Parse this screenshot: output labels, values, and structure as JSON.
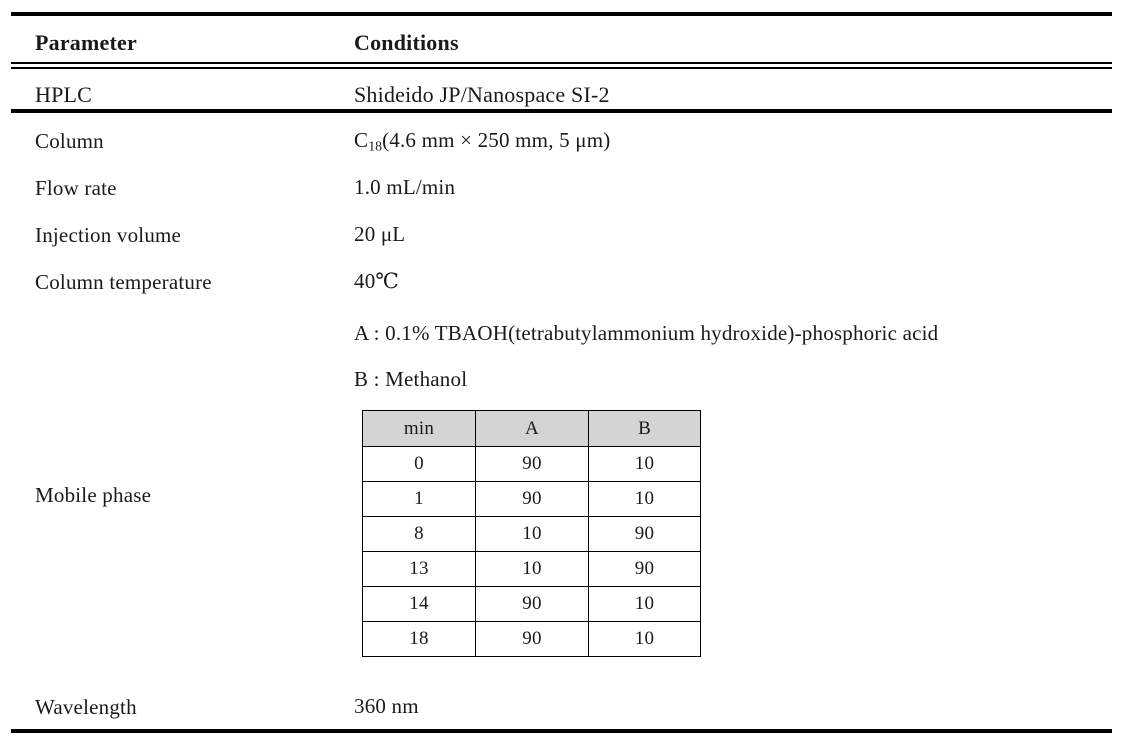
{
  "table": {
    "header": {
      "parameter": "Parameter",
      "conditions": "Conditions"
    },
    "rows": {
      "hplc": {
        "label": "HPLC",
        "value": "Shideido JP/Nanospace SI-2"
      },
      "column": {
        "label": "Column",
        "value_prefix": "C",
        "value_sub": "18",
        "value_suffix": "(4.6 mm × 250 mm, 5 μm)"
      },
      "flow_rate": {
        "label": "Flow rate",
        "value": "1.0 mL/min"
      },
      "injection_volume": {
        "label": "Injection volume",
        "value": "20 μL"
      },
      "column_temperature": {
        "label": "Column temperature",
        "value": "40℃"
      },
      "mobile_phase": {
        "label": "Mobile phase",
        "solvent_a": "A : 0.1% TBAOH(tetrabutylammonium hydroxide)-phosphoric acid",
        "solvent_b": "B : Methanol"
      },
      "wavelength": {
        "label": "Wavelength",
        "value": "360 nm"
      }
    }
  },
  "gradient_table": {
    "headers": [
      "min",
      "A",
      "B"
    ],
    "rows": [
      [
        "0",
        "90",
        "10"
      ],
      [
        "1",
        "90",
        "10"
      ],
      [
        "8",
        "10",
        "90"
      ],
      [
        "13",
        "10",
        "90"
      ],
      [
        "14",
        "90",
        "10"
      ],
      [
        "18",
        "90",
        "10"
      ]
    ],
    "header_fill": "#d4d4d4"
  }
}
